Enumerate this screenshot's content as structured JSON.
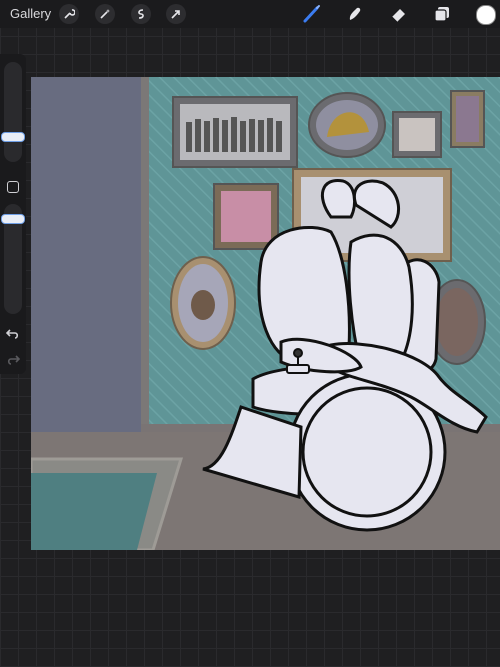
{
  "topbar": {
    "gallery_label": "Gallery",
    "left_tools": [
      "wrench-icon",
      "magic-wand-icon",
      "selection-icon",
      "transform-icon"
    ],
    "right_tools": [
      "brush-icon",
      "smudge-icon",
      "eraser-icon",
      "layers-icon"
    ],
    "active_tool": "brush-icon",
    "active_color": "#2f6fe0",
    "current_color": "#ffffff"
  },
  "sidebar": {
    "controls": [
      "brush-size-slider",
      "modify-button",
      "opacity-slider",
      "undo-icon",
      "redo-icon"
    ]
  },
  "canvas": {
    "wall_color": "#5f9597",
    "door_color": "#696d80",
    "floor_color": "#7d7674",
    "line_art_fill": "#e6e6f0"
  }
}
